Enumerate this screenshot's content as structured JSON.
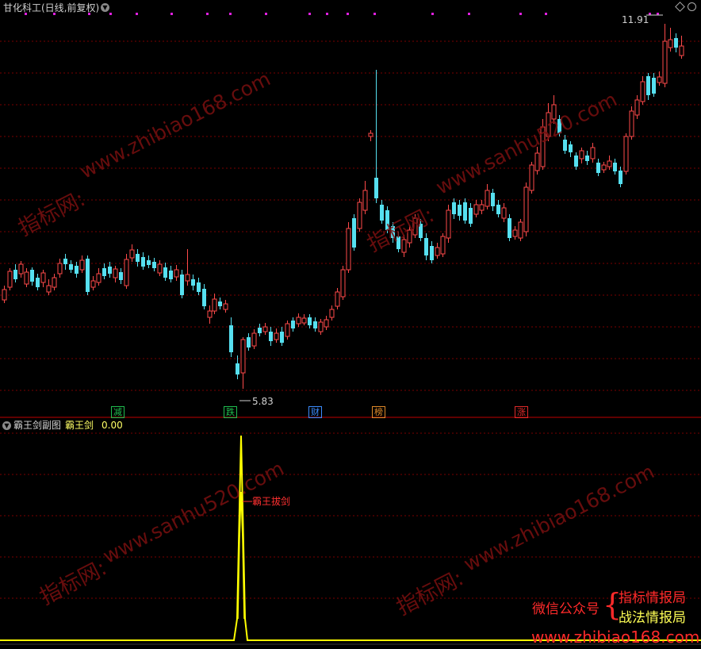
{
  "header": {
    "stock_title": "甘化科工(日线,前复权)"
  },
  "price_chart": {
    "high_label": "11.91",
    "low_label": "5.83",
    "markers": [
      {
        "text": "减",
        "color": "#1fbf4f"
      },
      {
        "text": "跌",
        "color": "#1fbf4f"
      },
      {
        "text": "财",
        "color": "#3c8cff"
      },
      {
        "text": "榜",
        "color": "#e08a2a"
      },
      {
        "text": "涨",
        "color": "#e02a2a"
      }
    ],
    "colors": {
      "up": "#ff4a4a",
      "down": "#56e0f0",
      "grid": "#7a0000",
      "separator": "#c00000"
    }
  },
  "indicator_panel": {
    "title": "霸王剑副图",
    "series_label": "霸王剑",
    "series_value": "0.00",
    "signal_label": "霸王拔剑",
    "line_color": "#ffff00"
  },
  "watermarks": {
    "site1": "www.zhibiao168.com",
    "site2": "www.sanhu520.com",
    "site3": "指标网:",
    "bottom_site": "www.zhibiao168.com"
  },
  "promo": {
    "wechat_label": "微信公众号",
    "brace": "{",
    "line1": "指标情报局",
    "line2": "战法情报局"
  }
}
